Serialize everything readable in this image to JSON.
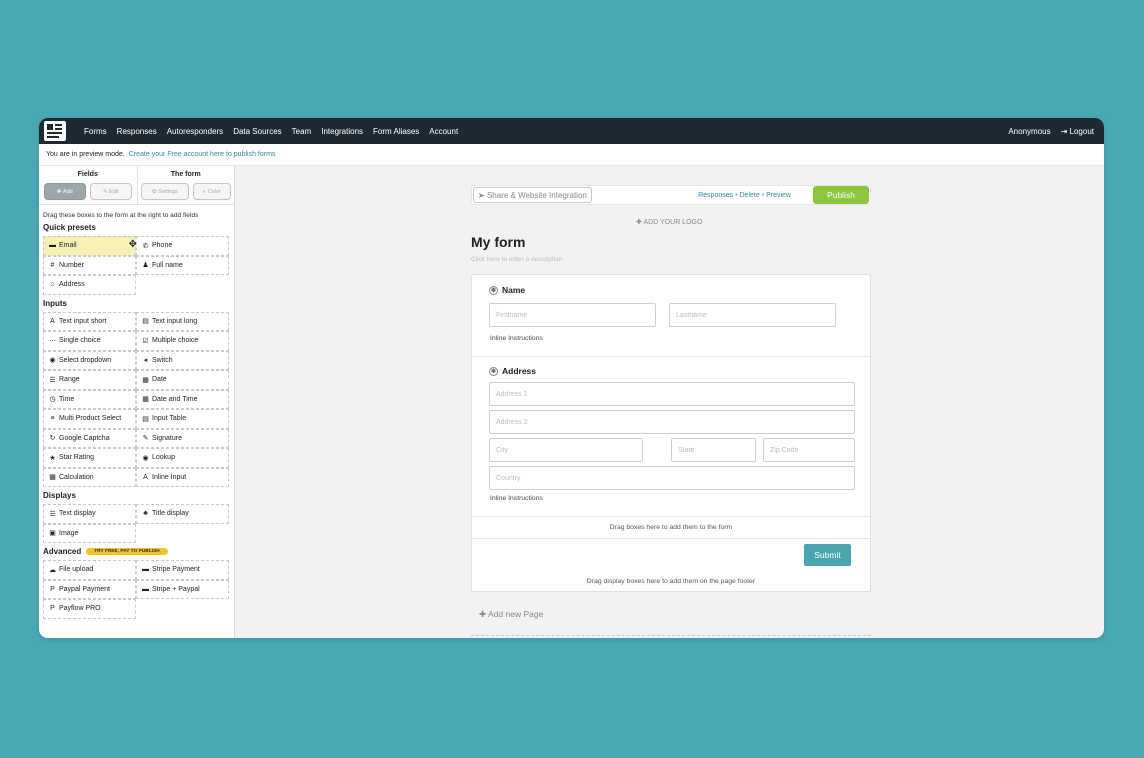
{
  "nav": {
    "links": [
      "Forms",
      "Responses",
      "Autoresponders",
      "Data Sources",
      "Team",
      "Integrations",
      "Form Aliases",
      "Account"
    ],
    "user": "Anonymous",
    "logout": "Logout"
  },
  "preview": {
    "text": "You are in preview mode.",
    "link": "Create your Free account here to publish forms"
  },
  "sidebar": {
    "fields_title": "Fields",
    "form_title": "The form",
    "add": "Add",
    "edit": "Edit",
    "settings": "Settings",
    "color": "Color",
    "hint": "Drag these boxes to the form at the right to add fields",
    "quick_presets": "Quick presets",
    "presets": [
      {
        "icon": "▬",
        "label": "Email"
      },
      {
        "icon": "✆",
        "label": "Phone"
      },
      {
        "icon": "#",
        "label": "Number"
      },
      {
        "icon": "♟",
        "label": "Full name"
      },
      {
        "icon": "⌂",
        "label": "Address"
      }
    ],
    "inputs_title": "Inputs",
    "inputs": [
      {
        "icon": "A",
        "label": "Text input short"
      },
      {
        "icon": "▤",
        "label": "Text input long"
      },
      {
        "icon": "⋯",
        "label": "Single choice"
      },
      {
        "icon": "☑",
        "label": "Multiple choice"
      },
      {
        "icon": "◉",
        "label": "Select dropdown"
      },
      {
        "icon": "◂",
        "label": "Switch"
      },
      {
        "icon": "☰",
        "label": "Range"
      },
      {
        "icon": "▦",
        "label": "Date"
      },
      {
        "icon": "◷",
        "label": "Time"
      },
      {
        "icon": "▦",
        "label": "Date and Time"
      },
      {
        "icon": "≡",
        "label": "Multi Product Select"
      },
      {
        "icon": "▤",
        "label": "Input Table"
      },
      {
        "icon": "↻",
        "label": "Google Captcha"
      },
      {
        "icon": "✎",
        "label": "Signature"
      },
      {
        "icon": "★",
        "label": "Star Rating"
      },
      {
        "icon": "◉",
        "label": "Lookup"
      },
      {
        "icon": "▦",
        "label": "Calculation"
      },
      {
        "icon": "A",
        "label": "Inline Input"
      }
    ],
    "displays_title": "Displays",
    "displays": [
      {
        "icon": "☰",
        "label": "Text display"
      },
      {
        "icon": "♣",
        "label": "Title display"
      },
      {
        "icon": "▣",
        "label": "Image"
      }
    ],
    "advanced_title": "Advanced",
    "advanced_badge": "TRY FREE, PAY TO PUBLISH",
    "advanced": [
      {
        "icon": "☁",
        "label": "File upload"
      },
      {
        "icon": "▬",
        "label": "Stripe Payment"
      },
      {
        "icon": "P",
        "label": "Paypal Payment"
      },
      {
        "icon": "▬",
        "label": "Stripe + Paypal"
      },
      {
        "icon": "P",
        "label": "Payflow PRO"
      }
    ]
  },
  "toolbar": {
    "share": "Share & Website Integration",
    "responses": "Responses",
    "delete": "Delete",
    "preview": "Preview",
    "sep": "•",
    "publish": "Publish"
  },
  "form": {
    "add_logo": "ADD YOUR LOGO",
    "title": "My form",
    "description": "Click here to enter a description",
    "name_label": "Name",
    "firstname": "Firstname",
    "lastname": "Lastname",
    "instructions": "Inline Instructions",
    "address_label": "Address",
    "address1": "Address 1",
    "address2": "Address 2",
    "city": "City",
    "state": "State",
    "zip": "Zip Code",
    "country": "Country",
    "drag_form": "Drag boxes here to add them to the form",
    "submit": "Submit",
    "drag_footer": "Drag display boxes here to add them on the page footer",
    "add_page": "Add new Page"
  }
}
